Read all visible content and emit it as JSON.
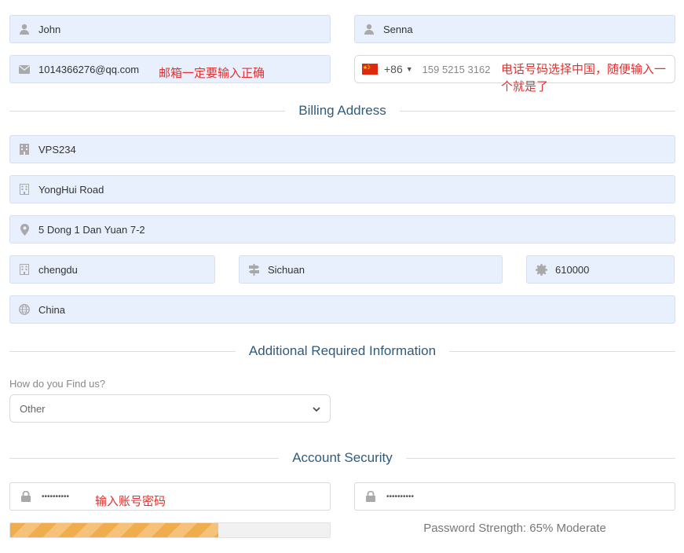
{
  "name": {
    "first": "John",
    "last": "Senna"
  },
  "contact": {
    "email": "1014366276@qq.com",
    "phone_code": "+86",
    "phone_value": "159 5215 3162",
    "country_flag": "cn-flag"
  },
  "annotations": {
    "email_note": "邮箱一定要输入正确",
    "phone_note_line1": "电话号码选择中国，随便输入一",
    "phone_note_line2": "个就是了",
    "password_note": "输入账号密码"
  },
  "billing": {
    "heading": "Billing Address",
    "company": "VPS234",
    "address1": "YongHui Road",
    "address2": "5 Dong 1 Dan Yuan 7-2",
    "city": "chengdu",
    "state": "Sichuan",
    "postcode": "610000",
    "country": "China"
  },
  "additional": {
    "heading": "Additional Required Information",
    "find_label": "How do you Find us?",
    "find_value": "Other"
  },
  "security": {
    "heading": "Account Security",
    "password_mask": "••••••••••",
    "confirm_mask": "••••••••••",
    "strength_fraction": 0.65,
    "strength_text": "Password Strength: 65% Moderate"
  },
  "colors": {
    "field_bg": "#e8f0fe",
    "heading": "#2f5b7c",
    "annotation": "#e0312f",
    "strength_bar": "#f0ad4e"
  },
  "icons": [
    "user-icon",
    "envelope-icon",
    "building-icon",
    "map-marker-icon",
    "signpost-icon",
    "certificate-icon",
    "globe-icon",
    "lock-icon",
    "chevron-down-icon"
  ]
}
